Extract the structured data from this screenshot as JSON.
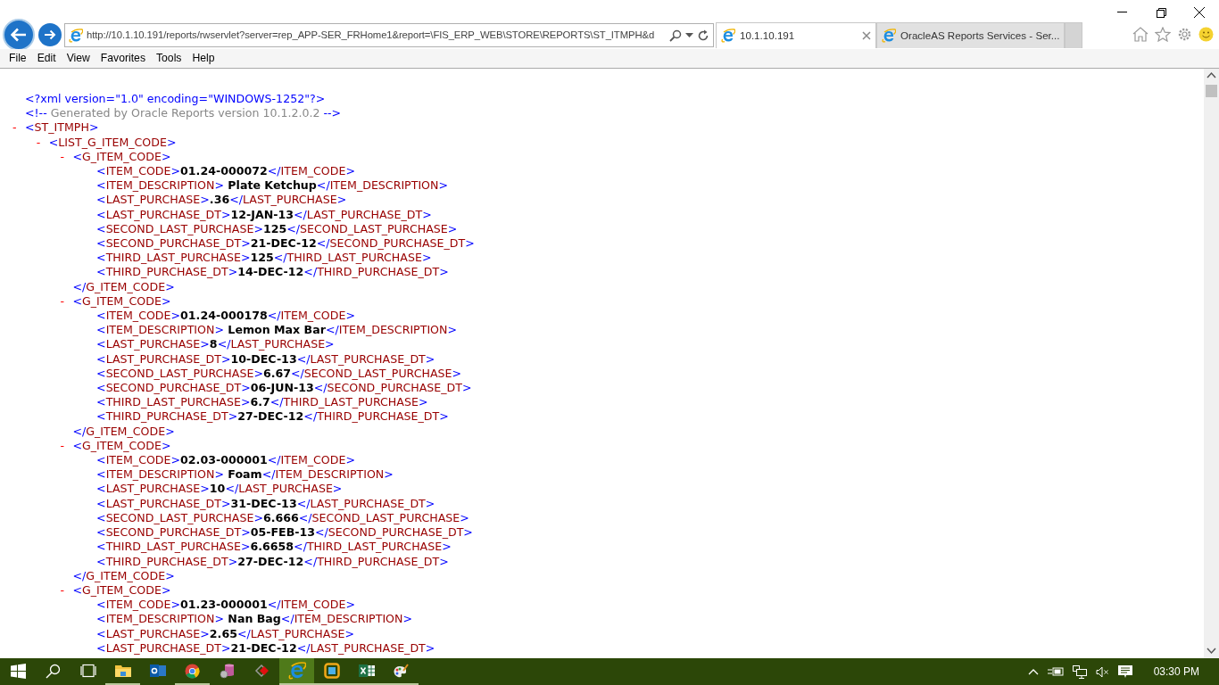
{
  "browser": {
    "address": "http://10.1.10.191/reports/rwservlet?server=rep_APP-SER_FRHome1&report=\\FIS_ERP_WEB\\STORE\\REPORTS\\ST_ITMPH&d",
    "tabs": [
      {
        "title": "10.1.10.191",
        "selected": true
      },
      {
        "title": "OracleAS Reports Services - Ser...",
        "selected": false
      }
    ],
    "menu": [
      "File",
      "Edit",
      "View",
      "Favorites",
      "Tools",
      "Help"
    ]
  },
  "xml": {
    "declaration": "<?xml version=\"1.0\" encoding=\"WINDOWS-1252\"?>",
    "comment": {
      "open": "<!--",
      "text": " Generated by Oracle Reports version 10.1.2.0.2 ",
      "close": "-->"
    },
    "root": {
      "toggle": "-",
      "open": "<ST_ITMPH>",
      "children": [
        {
          "toggle": "-",
          "open": "<LIST_G_ITEM_CODE>",
          "children": [
            {
              "toggle": "-",
              "open": "<G_ITEM_CODE>",
              "close": "</G_ITEM_CODE>",
              "children": [
                {
                  "open": "<ITEM_CODE>",
                  "value": "01.24-000072",
                  "close": "</ITEM_CODE>"
                },
                {
                  "open": "<ITEM_DESCRIPTION>",
                  "value": " Plate Ketchup",
                  "close": "</ITEM_DESCRIPTION>"
                },
                {
                  "open": "<LAST_PURCHASE>",
                  "value": ".36",
                  "close": "</LAST_PURCHASE>"
                },
                {
                  "open": "<LAST_PURCHASE_DT>",
                  "value": "12-JAN-13",
                  "close": "</LAST_PURCHASE_DT>"
                },
                {
                  "open": "<SECOND_LAST_PURCHASE>",
                  "value": "125",
                  "close": "</SECOND_LAST_PURCHASE>"
                },
                {
                  "open": "<SECOND_PURCHASE_DT>",
                  "value": "21-DEC-12",
                  "close": "</SECOND_PURCHASE_DT>"
                },
                {
                  "open": "<THIRD_LAST_PURCHASE>",
                  "value": "125",
                  "close": "</THIRD_LAST_PURCHASE>"
                },
                {
                  "open": "<THIRD_PURCHASE_DT>",
                  "value": "14-DEC-12",
                  "close": "</THIRD_PURCHASE_DT>"
                }
              ]
            },
            {
              "toggle": "-",
              "open": "<G_ITEM_CODE>",
              "close": "</G_ITEM_CODE>",
              "children": [
                {
                  "open": "<ITEM_CODE>",
                  "value": "01.24-000178",
                  "close": "</ITEM_CODE>"
                },
                {
                  "open": "<ITEM_DESCRIPTION>",
                  "value": " Lemon Max Bar",
                  "close": "</ITEM_DESCRIPTION>"
                },
                {
                  "open": "<LAST_PURCHASE>",
                  "value": "8",
                  "close": "</LAST_PURCHASE>"
                },
                {
                  "open": "<LAST_PURCHASE_DT>",
                  "value": "10-DEC-13",
                  "close": "</LAST_PURCHASE_DT>"
                },
                {
                  "open": "<SECOND_LAST_PURCHASE>",
                  "value": "6.67",
                  "close": "</SECOND_LAST_PURCHASE>"
                },
                {
                  "open": "<SECOND_PURCHASE_DT>",
                  "value": "06-JUN-13",
                  "close": "</SECOND_PURCHASE_DT>"
                },
                {
                  "open": "<THIRD_LAST_PURCHASE>",
                  "value": "6.7",
                  "close": "</THIRD_LAST_PURCHASE>"
                },
                {
                  "open": "<THIRD_PURCHASE_DT>",
                  "value": "27-DEC-12",
                  "close": "</THIRD_PURCHASE_DT>"
                }
              ]
            },
            {
              "toggle": "-",
              "open": "<G_ITEM_CODE>",
              "close": "</G_ITEM_CODE>",
              "children": [
                {
                  "open": "<ITEM_CODE>",
                  "value": "02.03-000001",
                  "close": "</ITEM_CODE>"
                },
                {
                  "open": "<ITEM_DESCRIPTION>",
                  "value": " Foam",
                  "close": "</ITEM_DESCRIPTION>"
                },
                {
                  "open": "<LAST_PURCHASE>",
                  "value": "10",
                  "close": "</LAST_PURCHASE>"
                },
                {
                  "open": "<LAST_PURCHASE_DT>",
                  "value": "31-DEC-13",
                  "close": "</LAST_PURCHASE_DT>"
                },
                {
                  "open": "<SECOND_LAST_PURCHASE>",
                  "value": "6.666",
                  "close": "</SECOND_LAST_PURCHASE>"
                },
                {
                  "open": "<SECOND_PURCHASE_DT>",
                  "value": "05-FEB-13",
                  "close": "</SECOND_PURCHASE_DT>"
                },
                {
                  "open": "<THIRD_LAST_PURCHASE>",
                  "value": "6.6658",
                  "close": "</THIRD_LAST_PURCHASE>"
                },
                {
                  "open": "<THIRD_PURCHASE_DT>",
                  "value": "27-DEC-12",
                  "close": "</THIRD_PURCHASE_DT>"
                }
              ]
            },
            {
              "toggle": "-",
              "open": "<G_ITEM_CODE>",
              "children": [
                {
                  "open": "<ITEM_CODE>",
                  "value": "01.23-000001",
                  "close": "</ITEM_CODE>"
                },
                {
                  "open": "<ITEM_DESCRIPTION>",
                  "value": " Nan Bag",
                  "close": "</ITEM_DESCRIPTION>"
                },
                {
                  "open": "<LAST_PURCHASE>",
                  "value": "2.65",
                  "close": "</LAST_PURCHASE>"
                },
                {
                  "open": "<LAST_PURCHASE_DT>",
                  "value": "21-DEC-12",
                  "close": "</LAST_PURCHASE_DT>"
                }
              ]
            }
          ]
        }
      ]
    }
  },
  "taskbar": {
    "apps": [
      {
        "kind": "folder",
        "selected": false,
        "running": true
      },
      {
        "kind": "mail",
        "selected": false,
        "running": false
      },
      {
        "kind": "chrome",
        "selected": false,
        "running": true
      },
      {
        "kind": "database",
        "selected": false,
        "running": false
      },
      {
        "kind": "diamond",
        "selected": false,
        "running": false
      },
      {
        "kind": "ie",
        "selected": true,
        "running": true
      },
      {
        "kind": "square",
        "selected": false,
        "running": true
      },
      {
        "kind": "excel",
        "selected": false,
        "running": true
      },
      {
        "kind": "paint",
        "selected": false,
        "running": true
      }
    ],
    "clock": "03:30 PM"
  }
}
